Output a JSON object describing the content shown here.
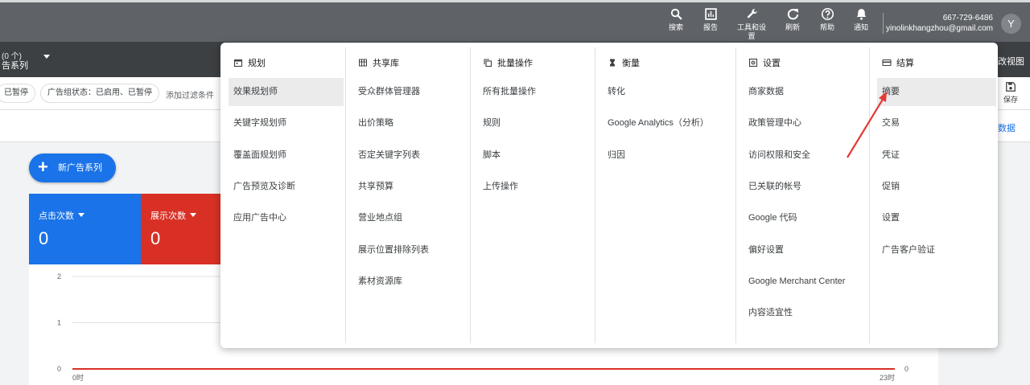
{
  "topbar": {
    "items": [
      {
        "label": "搜索",
        "icon": "search-icon"
      },
      {
        "label": "报告",
        "icon": "reports-icon"
      },
      {
        "label": "工具和设置",
        "icon": "wrench-icon"
      },
      {
        "label": "刷新",
        "icon": "refresh-icon"
      },
      {
        "label": "帮助",
        "icon": "help-icon"
      },
      {
        "label": "通知",
        "icon": "bell-icon"
      }
    ],
    "account_id": "667-729-6486",
    "account_email": "yinolinkhangzhou@gmail.com",
    "avatar_letter": "Y"
  },
  "campaign_bar": {
    "count_text": "(0 个)",
    "campaign_label": "告系列",
    "view_label": "改视图"
  },
  "filters": {
    "chip_paused": "已暂停",
    "chip_adgroup_status": "广告组状态：已启用、已暂停",
    "add_filter": "添加过滤条件",
    "save_label": "保存",
    "data_link": "数据"
  },
  "new_campaign": {
    "label": "新广告系列"
  },
  "metrics": [
    {
      "label": "点击次数",
      "value": "0",
      "color": "#1a73e8"
    },
    {
      "label": "展示次数",
      "value": "0",
      "color": "#d93025"
    }
  ],
  "chart_data": {
    "type": "line",
    "x": [
      "0时",
      "23时"
    ],
    "y_ticks": [
      "2",
      "1",
      "0"
    ],
    "right_ticks": [
      "0"
    ],
    "series": [
      {
        "values": [
          0,
          0
        ],
        "color": "#d93025"
      }
    ],
    "ylim": [
      0,
      2
    ]
  },
  "menu": {
    "columns": [
      {
        "title": "规划",
        "icon": "calendar-icon",
        "items": [
          "效果规划师",
          "关键字规划师",
          "覆盖面规划师",
          "广告预览及诊断",
          "应用广告中心"
        ],
        "selected": 0
      },
      {
        "title": "共享库",
        "icon": "library-icon",
        "items": [
          "受众群体管理器",
          "出价策略",
          "否定关键字列表",
          "共享预算",
          "营业地点组",
          "展示位置排除列表",
          "素材资源库"
        ],
        "selected": -1
      },
      {
        "title": "批量操作",
        "icon": "copy-icon",
        "items": [
          "所有批量操作",
          "规则",
          "脚本",
          "上传操作"
        ],
        "selected": -1
      },
      {
        "title": "衡量",
        "icon": "hourglass-icon",
        "items": [
          "转化",
          "Google Analytics（分析）",
          "归因"
        ],
        "selected": -1
      },
      {
        "title": "设置",
        "icon": "settings-box-icon",
        "items": [
          "商家数据",
          "政策管理中心",
          "访问权限和安全",
          "已关联的帐号",
          "Google 代码",
          "偏好设置",
          "Google Merchant Center",
          "内容适宜性"
        ],
        "selected": -1
      },
      {
        "title": "结算",
        "icon": "credit-card-icon",
        "items": [
          "摘要",
          "交易",
          "凭证",
          "促销",
          "设置",
          "广告客户验证"
        ],
        "selected": 0
      }
    ]
  },
  "annotation": {
    "arrow_color": "#e53935"
  }
}
